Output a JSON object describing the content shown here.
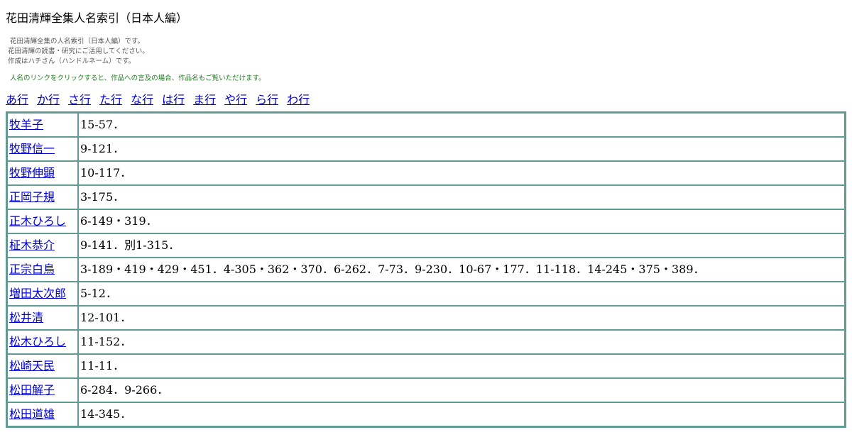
{
  "page": {
    "title": "花田清輝全集人名索引（日本人編）",
    "intro_lines": [
      "花田清輝全集の人名索引（日本人編）です。",
      "花田清輝の読書・研究にご活用してください。",
      "作成はハチさん（ハンドルネーム）です。"
    ],
    "note": "人名のリンクをクリックすると、作品への言及の場合、作品名もご覧いただけます。"
  },
  "kana_nav": [
    "あ行",
    "か行",
    "さ行",
    "た行",
    "な行",
    "は行",
    "ま行",
    "や行",
    "ら行",
    "わ行"
  ],
  "colors": {
    "link": "#0000cc",
    "table_border": "#5f9a93",
    "note_text": "#1f7a1f"
  },
  "entries": [
    {
      "name": "牧羊子",
      "refs": "15-57．"
    },
    {
      "name": "牧野信一",
      "refs": "9-121．"
    },
    {
      "name": "牧野伸顕",
      "refs": "10-117．"
    },
    {
      "name": "正岡子規",
      "refs": "3-175．"
    },
    {
      "name": "正木ひろし",
      "refs": "6-149・319．"
    },
    {
      "name": "柾木恭介",
      "refs": "9-141．別1-315．"
    },
    {
      "name": "正宗白鳥",
      "refs": "3-189・419・429・451．4-305・362・370．6-262．7-73．9-230．10-67・177．11-118．14-245・375・389．"
    },
    {
      "name": "増田太次郎",
      "refs": "5-12．"
    },
    {
      "name": "松井清",
      "refs": "12-101．"
    },
    {
      "name": "松木ひろし",
      "refs": "11-152．"
    },
    {
      "name": "松崎天民",
      "refs": "11-11．"
    },
    {
      "name": "松田解子",
      "refs": "6-284．9-266．"
    },
    {
      "name": "松田道雄",
      "refs": "14-345．"
    }
  ]
}
